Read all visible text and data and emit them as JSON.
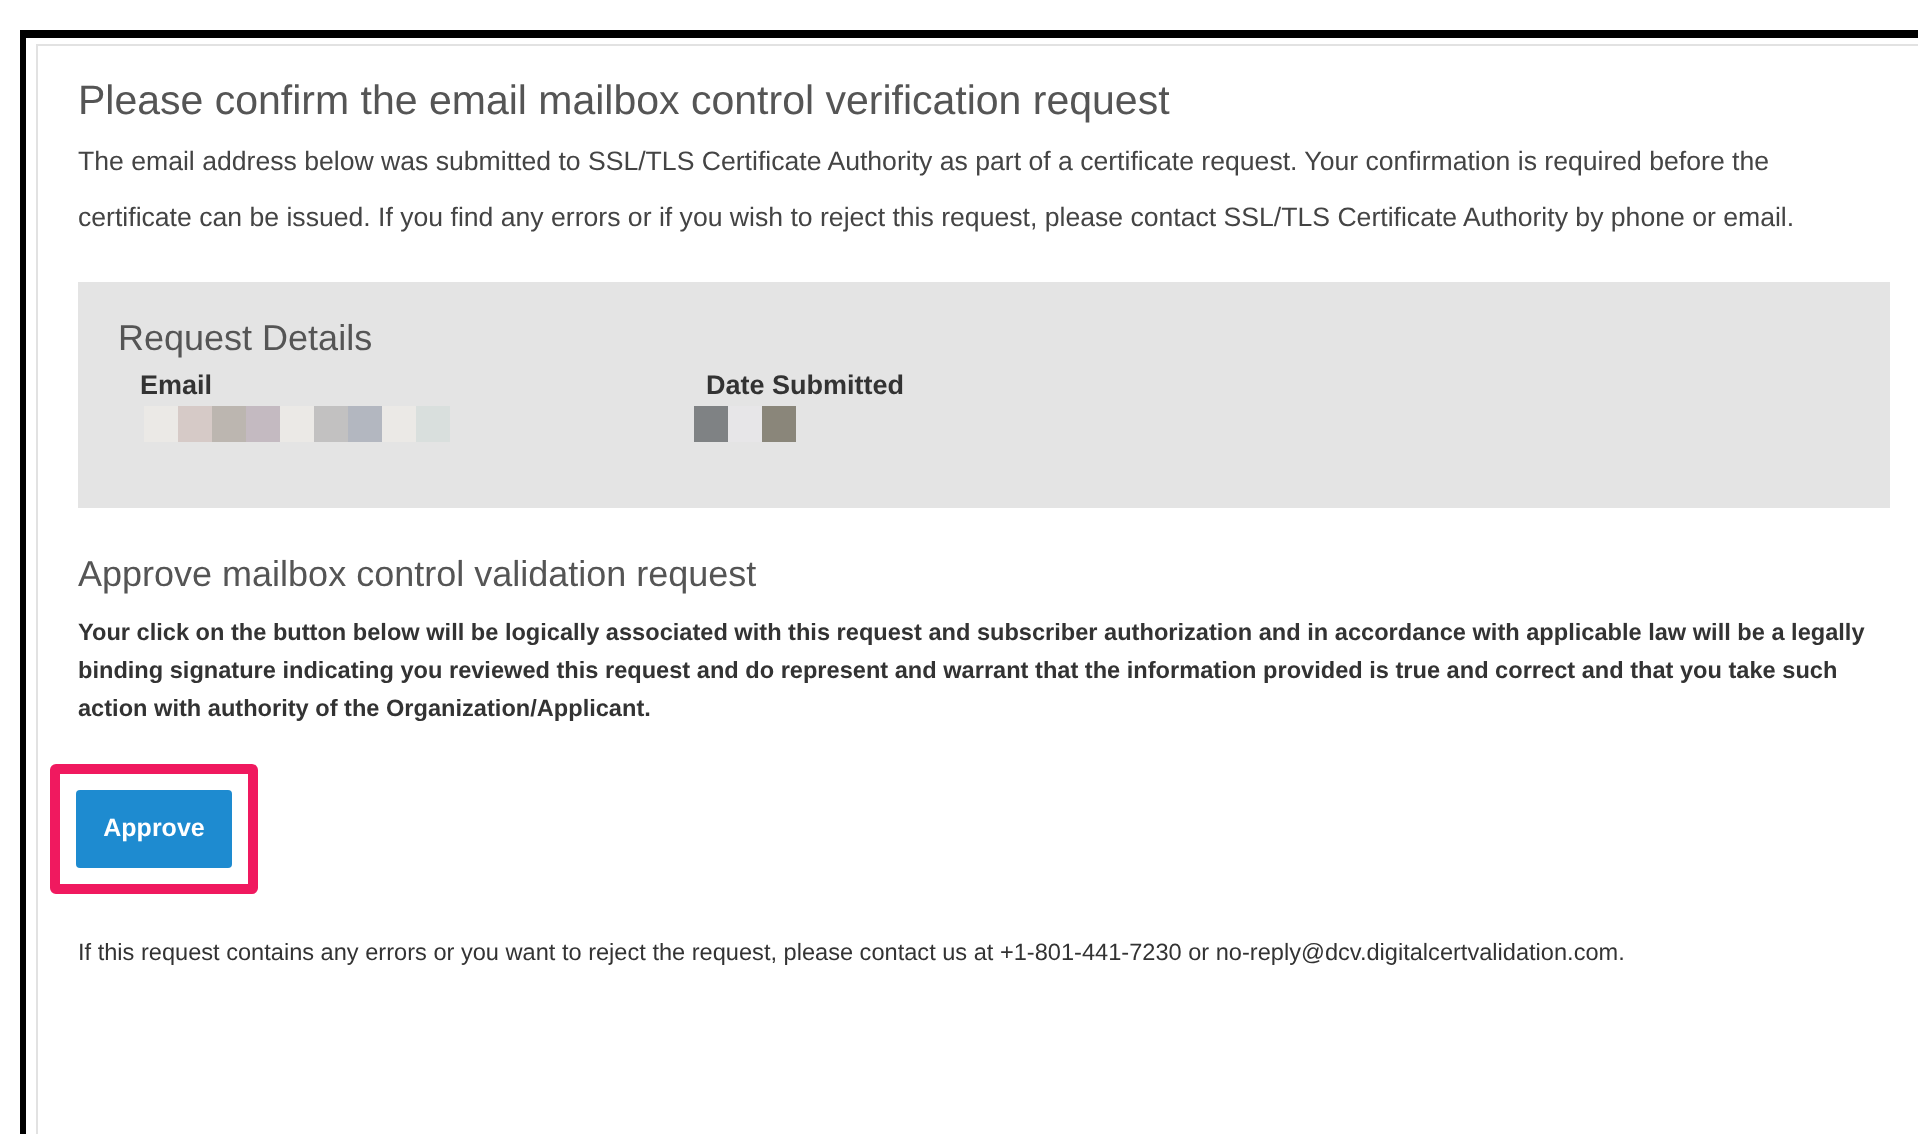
{
  "title": "Please confirm the email mailbox control verification request",
  "intro": "The email address below was submitted to SSL/TLS Certificate Authority as part of a certificate request. Your confirmation is required before the certificate can be issued. If you find any errors or if you wish to reject this request, please contact SSL/TLS Certificate Authority by phone or email.",
  "request_details": {
    "heading": "Request Details",
    "fields": [
      {
        "label": "Email",
        "redacted": true
      },
      {
        "label": "Date Submitted",
        "redacted": true
      }
    ]
  },
  "approve_section": {
    "heading": "Approve mailbox control validation request",
    "notice": "Your click on the button below will be logically associated with this request and subscriber authorization and in accordance with applicable law will be a legally binding signature indicating you reviewed this request and do represent and warrant that the information provided is true and correct and that you take such action with authority of the Organization/Applicant.",
    "button": {
      "label": "Approve",
      "highlighted": true
    }
  },
  "footer": "If this request contains any errors or you want to reject the request, please contact us at +1-801-441-7230 or no-reply@dcv.digitalcertvalidation.com."
}
